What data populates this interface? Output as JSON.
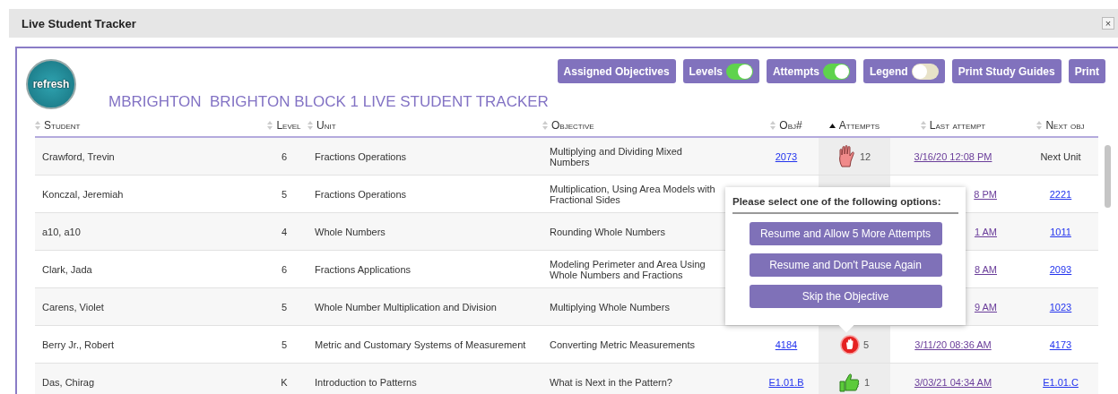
{
  "window": {
    "title": "Live Student Tracker",
    "close": "×"
  },
  "logo": {
    "text": "refresh"
  },
  "tracker_title": "MBRIGHTON  BRIGHTON BLOCK 1 LIVE STUDENT TRACKER",
  "toolbar": [
    {
      "kind": "button",
      "label": "Assigned Objectives"
    },
    {
      "kind": "toggle",
      "label": "Levels",
      "on": true
    },
    {
      "kind": "toggle",
      "label": "Attempts",
      "on": true
    },
    {
      "kind": "toggle",
      "label": "Legend",
      "on": false
    },
    {
      "kind": "button",
      "label": "Print Study Guides"
    },
    {
      "kind": "button",
      "label": "Print"
    }
  ],
  "table": {
    "columns": [
      {
        "label": "Student",
        "sorted": false
      },
      {
        "label": "Level",
        "sorted": false
      },
      {
        "label": "Unit",
        "sorted": false
      },
      {
        "label": "Objective",
        "sorted": false
      },
      {
        "label": "Obj#",
        "sorted": false
      },
      {
        "label": "Attempts",
        "sorted": true
      },
      {
        "label": "Last attempt",
        "sorted": false
      },
      {
        "label": "Next obj",
        "sorted": false
      }
    ],
    "rows": [
      {
        "student": "Crawford, Trevin",
        "level": "6",
        "unit": "Fractions Operations",
        "objective": "Multiplying and Dividing Mixed Numbers",
        "obj": "2073",
        "attempt": {
          "kind": "hand",
          "count": "12"
        },
        "last_attempt": "3/16/20 12:08 PM",
        "next_obj": "Next Unit",
        "next_is_link": false
      },
      {
        "student": "Konczal, Jeremiah",
        "level": "5",
        "unit": "Fractions Operations",
        "objective": "Multiplication, Using Area Models with Fractional Sides",
        "last_attempt": "8 PM",
        "next_obj": "2221",
        "next_is_link": true
      },
      {
        "student": "a10, a10",
        "level": "4",
        "unit": "Whole Numbers",
        "objective": "Rounding Whole Numbers",
        "last_attempt": "1 AM",
        "next_obj": "1011",
        "next_is_link": true
      },
      {
        "student": "Clark, Jada",
        "level": "6",
        "unit": "Fractions Applications",
        "objective": "Modeling Perimeter and Area Using Whole Numbers and Fractions",
        "last_attempt": "8 AM",
        "next_obj": "2093",
        "next_is_link": true
      },
      {
        "student": "Carens, Violet",
        "level": "5",
        "unit": "Whole Number Multiplication and Division",
        "objective": "Multiplying Whole Numbers",
        "last_attempt": "9 AM",
        "next_obj": "1023",
        "next_is_link": true
      },
      {
        "student": "Berry Jr., Robert",
        "level": "5",
        "unit": "Metric and Customary Systems of Measurement",
        "objective": "Converting Metric Measurements",
        "obj": "4184",
        "attempt": {
          "kind": "stop",
          "count": "5"
        },
        "last_attempt": "3/11/20 08:36 AM",
        "next_obj": "4173",
        "next_is_link": true
      },
      {
        "student": "Das, Chirag",
        "level": "K",
        "unit": "Introduction to Patterns",
        "objective": "What is Next in the Pattern?",
        "obj": "E1.01.B",
        "attempt": {
          "kind": "thumb",
          "count": "1"
        },
        "last_attempt": "3/03/21 04:34 AM",
        "next_obj": "E1.01.C",
        "next_is_link": true
      }
    ]
  },
  "popover": {
    "title": "Please select one of the following options:",
    "options": [
      "Resume and Allow 5 More Attempts",
      "Resume and Don't Pause Again",
      "Skip the Objective"
    ]
  }
}
